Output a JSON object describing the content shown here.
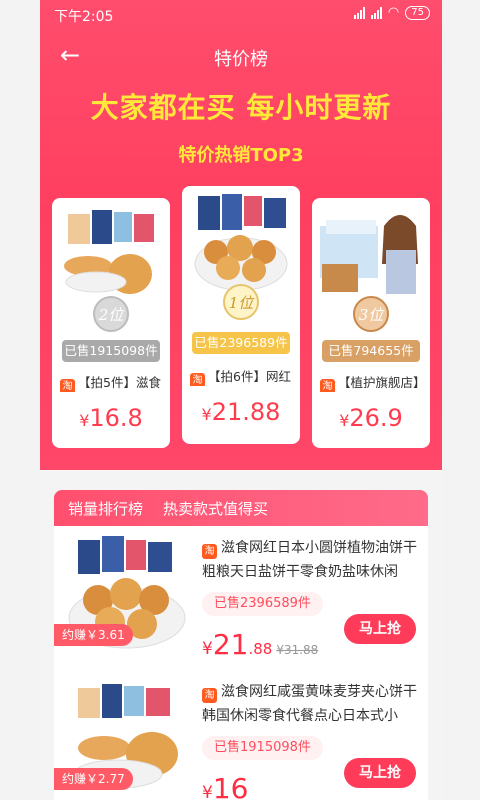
{
  "status": {
    "time": "下午2:05",
    "battery": "75"
  },
  "nav": {
    "title": "特价榜"
  },
  "hero": {
    "headline": "大家都在买 每小时更新",
    "subhead": "特价热销TOP3"
  },
  "top3": [
    {
      "rank": "2位",
      "sold": "已售1915098件",
      "title": "【拍5件】滋食",
      "price_symbol": "¥",
      "price": "16.8"
    },
    {
      "rank": "1位",
      "sold": "已售2396589件",
      "title": "【拍6件】网红",
      "price_symbol": "¥",
      "price": "21.88"
    },
    {
      "rank": "3位",
      "sold": "已售794655件",
      "title": "【植护旗舰店】",
      "price_symbol": "¥",
      "price": "26.9"
    }
  ],
  "tabs": [
    "销量排行榜",
    "热卖款式值得买"
  ],
  "list": [
    {
      "title": "滋食网红日本小圆饼植物油饼干粗粮天日盐饼干零食奶盐味休闲",
      "sold": "已售2396589件",
      "earn": "约赚￥3.61",
      "price_symbol": "¥",
      "price_int": "21",
      "price_dec": ".88",
      "old_price": "¥31.88",
      "buy": "马上抢"
    },
    {
      "title": "滋食网红咸蛋黄味麦芽夹心饼干韩国休闲零食代餐点心日本式小",
      "sold": "已售1915098件",
      "earn": "约赚￥2.77",
      "price_symbol": "¥",
      "price_int": "16",
      "price_dec": "",
      "old_price": "",
      "buy": "马上抢"
    }
  ],
  "icon_taobao": "淘",
  "colors": {
    "accent": "#ff3f5f",
    "headline": "#ffe83a",
    "price": "#ff2d44"
  }
}
